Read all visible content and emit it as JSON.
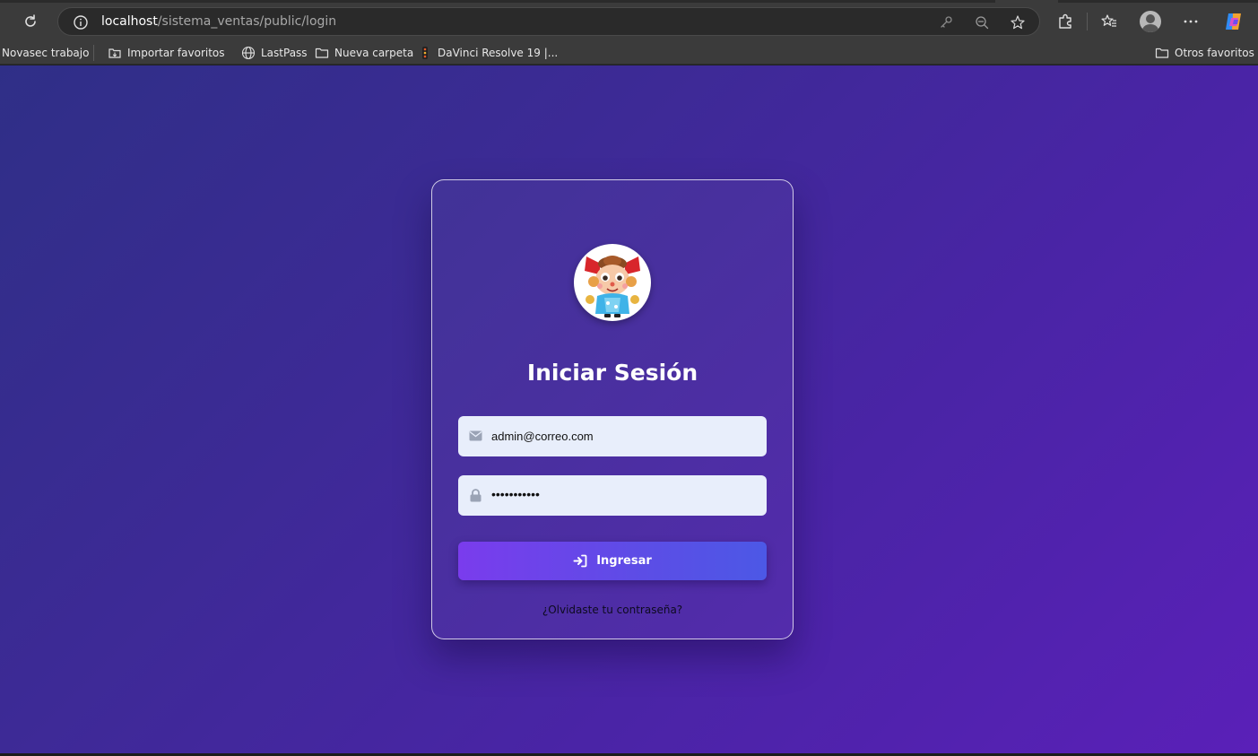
{
  "browser": {
    "url_host": "localhost",
    "url_path": "/sistema_ventas/public/login",
    "bookmarks": [
      {
        "label": "Novasec trabajo",
        "icon": "none"
      },
      {
        "label": "Importar favoritos",
        "icon": "import-icon"
      },
      {
        "label": "LastPass",
        "icon": "globe-icon"
      },
      {
        "label": "Nueva carpeta",
        "icon": "folder-icon"
      },
      {
        "label": "DaVinci Resolve 19 |...",
        "icon": "davinci-icon"
      }
    ],
    "other_bookmarks": "Otros favoritos"
  },
  "login": {
    "title": "Iniciar Sesión",
    "email_value": "admin@correo.com",
    "password_value": "•••••••••••",
    "submit_label": "Ingresar",
    "forgot_link": "¿Olvidaste tu contraseña?"
  },
  "colors": {
    "bg_start": "#2f2f87",
    "bg_end": "#5a20b8",
    "button_start": "#7a3ced",
    "button_end": "#4c58e6",
    "field_bg": "#e8eefb"
  }
}
